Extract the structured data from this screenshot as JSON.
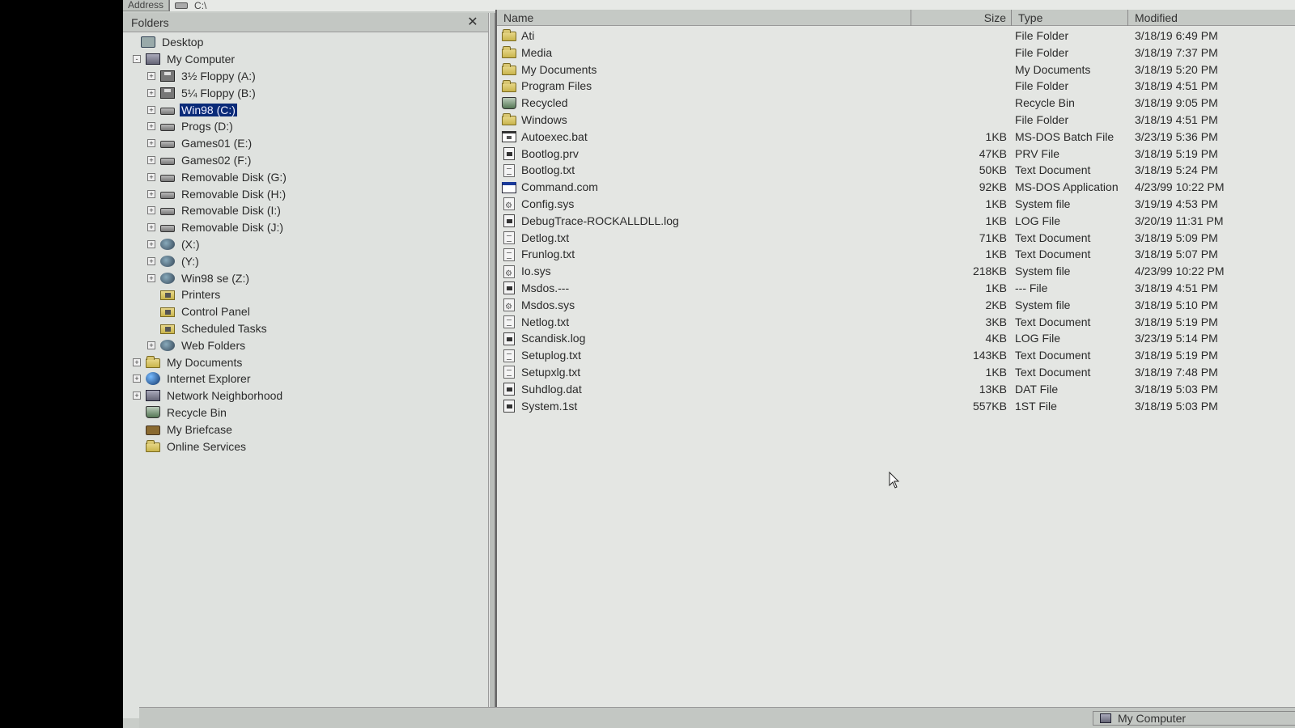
{
  "address": {
    "label": "Address",
    "path": "C:\\"
  },
  "folders": {
    "title": "Folders",
    "close_label": "✕",
    "items": [
      {
        "label": "Desktop",
        "level": 0,
        "exp": "none",
        "icon": "desktop"
      },
      {
        "label": "My Computer",
        "level": 1,
        "exp": "-",
        "icon": "computer"
      },
      {
        "label": "3½ Floppy (A:)",
        "level": 2,
        "exp": "+",
        "icon": "floppy"
      },
      {
        "label": "5¼ Floppy (B:)",
        "level": 2,
        "exp": "+",
        "icon": "floppy"
      },
      {
        "label": "Win98 (C:)",
        "level": 2,
        "exp": "+",
        "icon": "drive",
        "selected": true
      },
      {
        "label": "Progs (D:)",
        "level": 2,
        "exp": "+",
        "icon": "drive"
      },
      {
        "label": "Games01 (E:)",
        "level": 2,
        "exp": "+",
        "icon": "drive"
      },
      {
        "label": "Games02 (F:)",
        "level": 2,
        "exp": "+",
        "icon": "drive"
      },
      {
        "label": "Removable Disk (G:)",
        "level": 2,
        "exp": "+",
        "icon": "drive"
      },
      {
        "label": "Removable Disk (H:)",
        "level": 2,
        "exp": "+",
        "icon": "drive"
      },
      {
        "label": "Removable Disk (I:)",
        "level": 2,
        "exp": "+",
        "icon": "drive"
      },
      {
        "label": "Removable Disk (J:)",
        "level": 2,
        "exp": "+",
        "icon": "drive"
      },
      {
        "label": "(X:)",
        "level": 2,
        "exp": "+",
        "icon": "net"
      },
      {
        "label": "(Y:)",
        "level": 2,
        "exp": "+",
        "icon": "net"
      },
      {
        "label": "Win98 se (Z:)",
        "level": 2,
        "exp": "+",
        "icon": "net"
      },
      {
        "label": "Printers",
        "level": 2,
        "exp": "none",
        "icon": "special"
      },
      {
        "label": "Control Panel",
        "level": 2,
        "exp": "none",
        "icon": "special"
      },
      {
        "label": "Scheduled Tasks",
        "level": 2,
        "exp": "none",
        "icon": "special"
      },
      {
        "label": "Web Folders",
        "level": 2,
        "exp": "+",
        "icon": "net"
      },
      {
        "label": "My Documents",
        "level": 1,
        "exp": "+",
        "icon": "folder"
      },
      {
        "label": "Internet Explorer",
        "level": 1,
        "exp": "+",
        "icon": "globe"
      },
      {
        "label": "Network Neighborhood",
        "level": 1,
        "exp": "+",
        "icon": "computer"
      },
      {
        "label": "Recycle Bin",
        "level": 1,
        "exp": "none",
        "icon": "recycle"
      },
      {
        "label": "My Briefcase",
        "level": 1,
        "exp": "none",
        "icon": "brief"
      },
      {
        "label": "Online Services",
        "level": 1,
        "exp": "none",
        "icon": "folder"
      }
    ]
  },
  "files": {
    "columns": {
      "name": "Name",
      "size": "Size",
      "type": "Type",
      "modified": "Modified"
    },
    "rows": [
      {
        "name": "Ati",
        "size": "",
        "type": "File Folder",
        "modified": "3/18/19 6:49 PM",
        "icon": "folder"
      },
      {
        "name": "Media",
        "size": "",
        "type": "File Folder",
        "modified": "3/18/19 7:37 PM",
        "icon": "folder"
      },
      {
        "name": "My Documents",
        "size": "",
        "type": "My Documents",
        "modified": "3/18/19 5:20 PM",
        "icon": "folder"
      },
      {
        "name": "Program Files",
        "size": "",
        "type": "File Folder",
        "modified": "3/18/19 4:51 PM",
        "icon": "folder"
      },
      {
        "name": "Recycled",
        "size": "",
        "type": "Recycle Bin",
        "modified": "3/18/19 9:05 PM",
        "icon": "recycle"
      },
      {
        "name": "Windows",
        "size": "",
        "type": "File Folder",
        "modified": "3/18/19 4:51 PM",
        "icon": "folder"
      },
      {
        "name": "Autoexec.bat",
        "size": "1KB",
        "type": "MS-DOS Batch File",
        "modified": "3/23/19 5:36 PM",
        "icon": "bat"
      },
      {
        "name": "Bootlog.prv",
        "size": "47KB",
        "type": "PRV File",
        "modified": "3/18/19 5:19 PM",
        "icon": "log"
      },
      {
        "name": "Bootlog.txt",
        "size": "50KB",
        "type": "Text Document",
        "modified": "3/18/19 5:24 PM",
        "icon": "file"
      },
      {
        "name": "Command.com",
        "size": "92KB",
        "type": "MS-DOS Application",
        "modified": "4/23/99 10:22 PM",
        "icon": "app"
      },
      {
        "name": "Config.sys",
        "size": "1KB",
        "type": "System file",
        "modified": "3/19/19 4:53 PM",
        "icon": "sys"
      },
      {
        "name": "DebugTrace-ROCKALLDLL.log",
        "size": "1KB",
        "type": "LOG File",
        "modified": "3/20/19 11:31 PM",
        "icon": "log"
      },
      {
        "name": "Detlog.txt",
        "size": "71KB",
        "type": "Text Document",
        "modified": "3/18/19 5:09 PM",
        "icon": "file"
      },
      {
        "name": "Frunlog.txt",
        "size": "1KB",
        "type": "Text Document",
        "modified": "3/18/19 5:07 PM",
        "icon": "file"
      },
      {
        "name": "Io.sys",
        "size": "218KB",
        "type": "System file",
        "modified": "4/23/99 10:22 PM",
        "icon": "sys"
      },
      {
        "name": "Msdos.---",
        "size": "1KB",
        "type": "--- File",
        "modified": "3/18/19 4:51 PM",
        "icon": "log"
      },
      {
        "name": "Msdos.sys",
        "size": "2KB",
        "type": "System file",
        "modified": "3/18/19 5:10 PM",
        "icon": "sys"
      },
      {
        "name": "Netlog.txt",
        "size": "3KB",
        "type": "Text Document",
        "modified": "3/18/19 5:19 PM",
        "icon": "file"
      },
      {
        "name": "Scandisk.log",
        "size": "4KB",
        "type": "LOG File",
        "modified": "3/23/19 5:14 PM",
        "icon": "log"
      },
      {
        "name": "Setuplog.txt",
        "size": "143KB",
        "type": "Text Document",
        "modified": "3/18/19 5:19 PM",
        "icon": "file"
      },
      {
        "name": "Setupxlg.txt",
        "size": "1KB",
        "type": "Text Document",
        "modified": "3/18/19 7:48 PM",
        "icon": "file"
      },
      {
        "name": "Suhdlog.dat",
        "size": "13KB",
        "type": "DAT File",
        "modified": "3/18/19 5:03 PM",
        "icon": "log"
      },
      {
        "name": "System.1st",
        "size": "557KB",
        "type": "1ST File",
        "modified": "3/18/19 5:03 PM",
        "icon": "log"
      }
    ]
  },
  "status": {
    "location": "My Computer"
  }
}
